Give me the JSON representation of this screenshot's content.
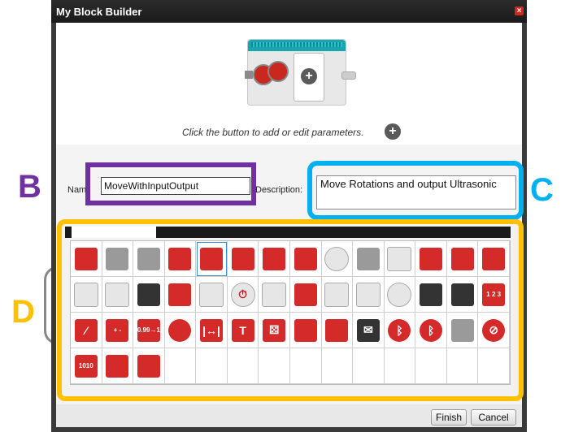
{
  "dialog": {
    "title": "My Block Builder",
    "close_glyph": "×"
  },
  "header": {
    "hint": "Click the button to add or edit parameters.",
    "add_param_glyph": "+"
  },
  "form": {
    "name_label": "Nam",
    "name_value": "MoveWithInputOutput",
    "description_label": "Description:",
    "description_value": "Move Rotations and output Ultrasonic"
  },
  "annotations": {
    "b": "B",
    "c": "C",
    "d": "D",
    "colors": {
      "b": "#7030a0",
      "c": "#00b0f0",
      "d": "#ffc000"
    }
  },
  "palette": {
    "icons": [
      [
        "brain-red-icon",
        "brain-gray-icon",
        "medium-motor-icon",
        "large-motor-icon",
        "move-tank-icon",
        "move-steering-icon",
        "move-tank-2-icon",
        "display-icon",
        "sound-icon",
        "brick-light-icon",
        "wait-icon",
        "loop-icon",
        "switch-icon",
        "loop-interrupt-icon"
      ],
      [
        "color-sensor-icon",
        "gyro-sensor-icon",
        "infrared-sensor-icon",
        "brick-buttons-icon",
        "motor-rotation-icon",
        "timer-icon",
        "touch-sensor-icon",
        "ultrasonic-sensor-icon",
        "energy-meter-icon",
        "temperature-icon",
        "nxt-sound-icon",
        "variable-icon",
        "constant-icon",
        "array-icon"
      ],
      [
        "logic-icon",
        "math-icon",
        "round-icon",
        "compare-icon",
        "range-icon",
        "text-icon",
        "random-icon",
        "file-access-icon",
        "data-logging-icon",
        "messaging-icon",
        "bluetooth-icon",
        "bluetooth-connect-icon",
        "keep-awake-icon",
        "stop-icon"
      ],
      [
        "raw-sensor-icon",
        "unregulated-motor-icon",
        "invert-motor-icon",
        "",
        "",
        "",
        "",
        "",
        "",
        "",
        "",
        "",
        "",
        ""
      ]
    ],
    "glyphs": {
      "math-icon": "+ -\n× ÷",
      "round-icon": "0.99→1",
      "range-icon": "|↔|",
      "text-icon": "T",
      "raw-sensor-icon": "1010\n0101",
      "array-icon": "1 2 3",
      "timer-icon": "⏱",
      "bluetooth-icon": "ᛒ",
      "bluetooth-connect-icon": "ᛒ",
      "stop-icon": "⊘",
      "logic-icon": "⁄",
      "random-icon": "⚄",
      "messaging-icon": "✉"
    }
  },
  "footer": {
    "finish_label": "Finish",
    "cancel_label": "Cancel"
  }
}
